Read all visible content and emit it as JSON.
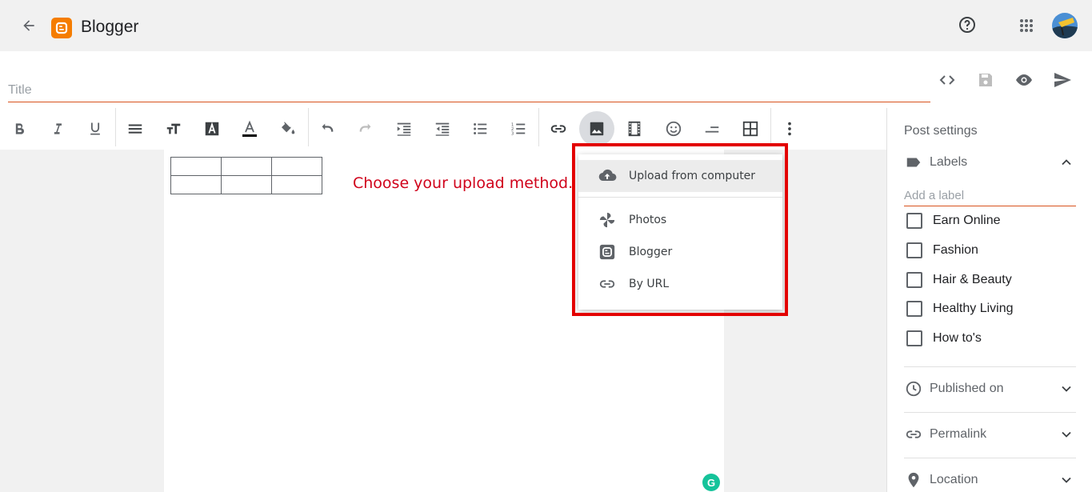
{
  "app": {
    "title": "Blogger"
  },
  "post": {
    "title_placeholder": "Title",
    "title_value": ""
  },
  "toolbar": {
    "buttons": [
      "bold",
      "italic",
      "underline",
      "align",
      "font-size",
      "text-style",
      "text-color",
      "highlight-color",
      "undo",
      "redo",
      "indent",
      "outdent",
      "bulleted-list",
      "numbered-list",
      "link",
      "insert-image",
      "insert-video",
      "emoji",
      "divider",
      "table",
      "more"
    ]
  },
  "editor": {
    "table": {
      "rows": 2,
      "cols": 3
    },
    "annotation": "Choose your upload method."
  },
  "upload_menu": {
    "items": [
      {
        "label": "Upload from computer",
        "icon": "cloud-upload-icon"
      },
      {
        "label": "Photos",
        "icon": "pinwheel-icon"
      },
      {
        "label": "Blogger",
        "icon": "blogger-icon"
      },
      {
        "label": "By URL",
        "icon": "link-icon"
      }
    ]
  },
  "sidebar": {
    "title": "Post settings",
    "labels_section": {
      "label": "Labels",
      "input_placeholder": "Add a label",
      "options": [
        "Earn Online",
        "Fashion",
        "Hair & Beauty",
        "Healthy Living",
        "How to's"
      ]
    },
    "sections": [
      {
        "label": "Published on",
        "icon": "clock-icon"
      },
      {
        "label": "Permalink",
        "icon": "link-icon"
      },
      {
        "label": "Location",
        "icon": "location-pin-icon"
      }
    ]
  },
  "colors": {
    "accent": "#f57d00",
    "underline": "#d9531e",
    "annotation": "#d0021b",
    "highlight_frame": "#e30000"
  }
}
